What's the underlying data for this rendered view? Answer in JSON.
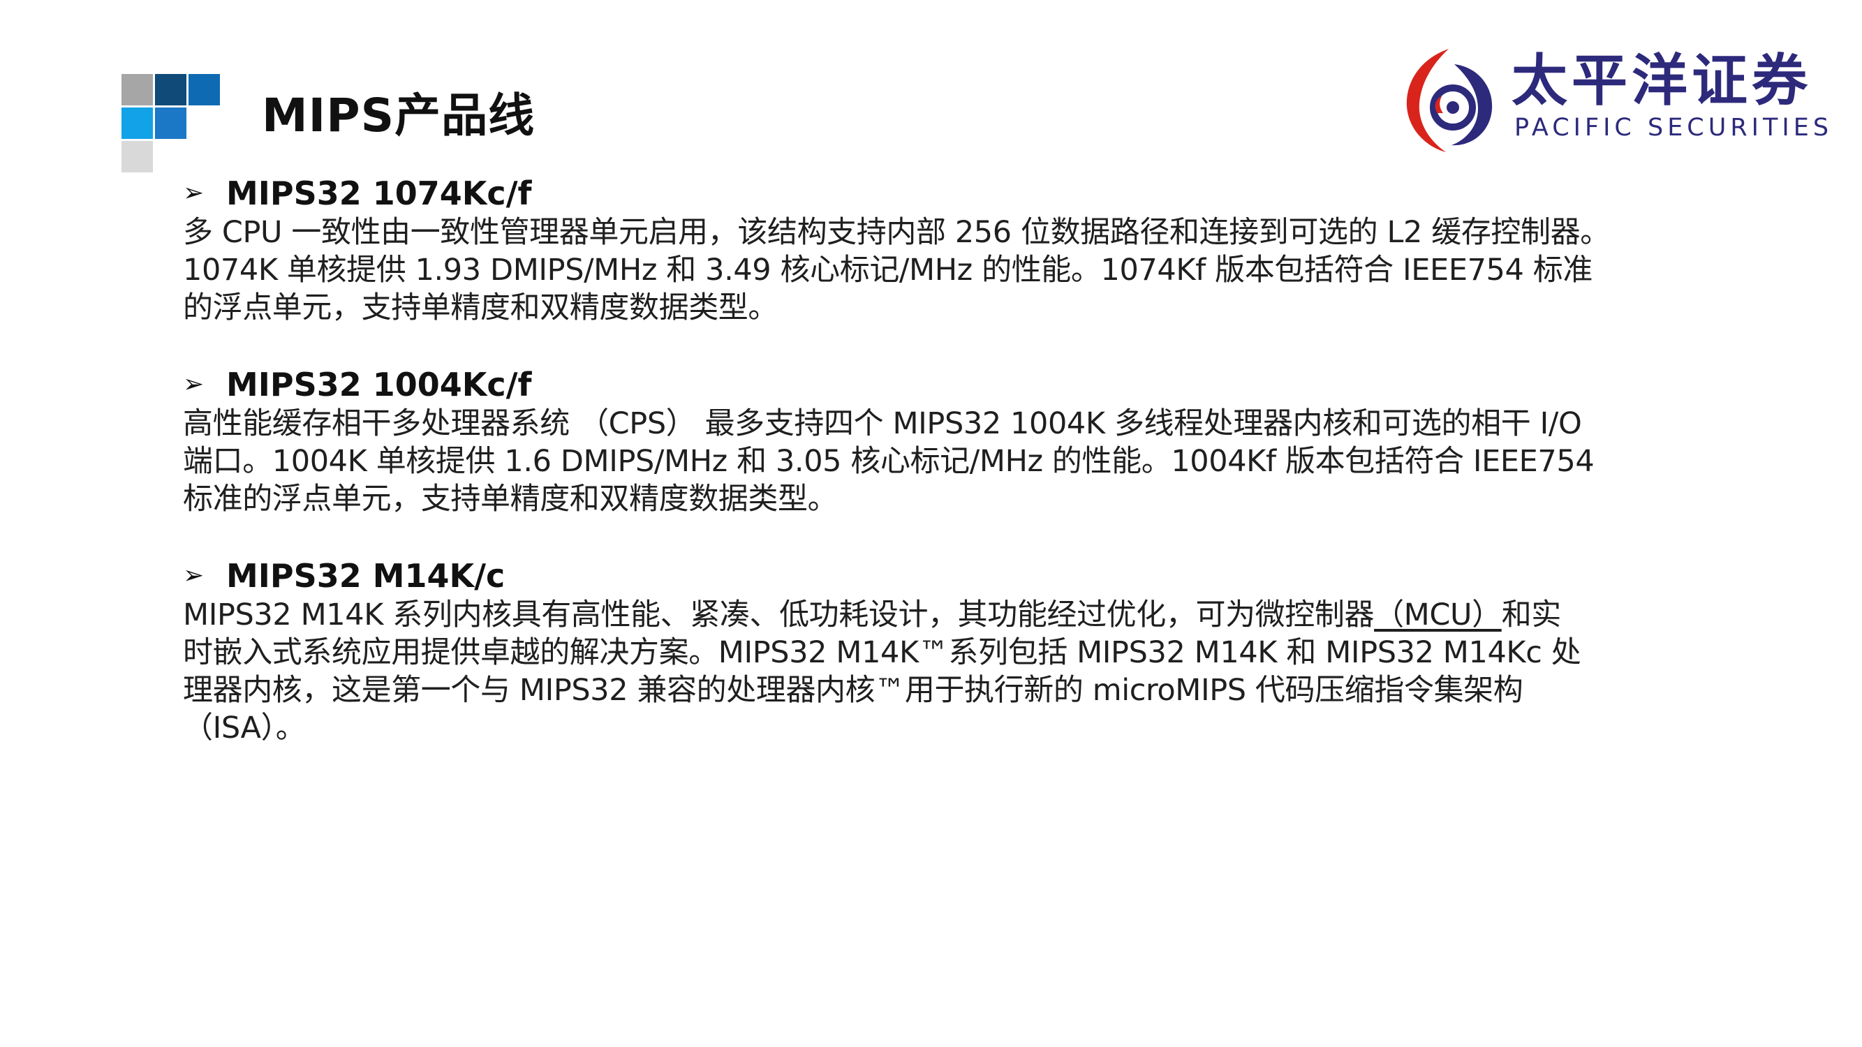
{
  "title": "MIPS产品线",
  "logo": {
    "cn_name": "太平洋证券",
    "en_name": "PACIFIC SECURITIES"
  },
  "colors": {
    "brand_navy": "#2d2a7c",
    "brand_red": "#d9241c",
    "mosaic_gray": "#a6a6a6",
    "mosaic_light_gray": "#d9d9d9",
    "mosaic_dark_blue": "#0f4a78",
    "mosaic_blue": "#0e6bb3",
    "mosaic_cyan": "#12a2e8",
    "mosaic_mid_blue": "#1a78c6"
  },
  "bullet_glyph": "➢",
  "sections": [
    {
      "title": "MIPS32 1074Kc/f",
      "lines": [
        "多 CPU 一致性由一致性管理器单元启用，该结构支持内部 256 位数据路径和连接到可选的 L2 缓存控制器。",
        "1074K 单核提供 1.93 DMIPS/MHz 和 3.49 核心标记/MHz 的性能。1074Kf 版本包括符合 IEEE754 标准",
        "的浮点单元，支持单精度和双精度数据类型。"
      ]
    },
    {
      "title": "MIPS32 1004Kc/f",
      "lines": [
        "高性能缓存相干多处理器系统 （CPS） 最多支持四个 MIPS32 1004K 多线程处理器内核和可选的相干 I/O",
        "端口。1004K 单核提供 1.6 DMIPS/MHz 和 3.05 核心标记/MHz 的性能。1004Kf 版本包括符合 IEEE754",
        "标准的浮点单元，支持单精度和双精度数据类型。"
      ]
    },
    {
      "title": "MIPS32 M14K/c",
      "line1_before": "MIPS32 M14K 系列内核具有高性能、紧凑、低功耗设计，其功能经过优化，可为微控制器",
      "line1_underlined": "（MCU）",
      "line1_after": "和实",
      "lines": [
        "时嵌入式系统应用提供卓越的解决方案。MIPS32 M14K™系列包括 MIPS32 M14K 和 MIPS32 M14Kc 处",
        "理器内核，这是第一个与 MIPS32 兼容的处理器内核™用于执行新的 microMIPS 代码压缩指令集架构",
        "（ISA）。"
      ]
    }
  ]
}
